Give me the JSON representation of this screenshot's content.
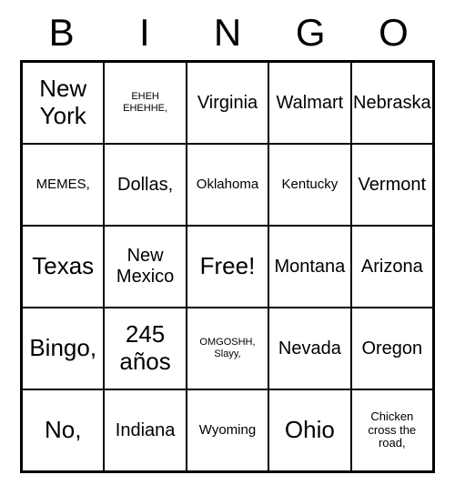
{
  "header": [
    "B",
    "I",
    "N",
    "G",
    "O"
  ],
  "cells": [
    {
      "text": "New York",
      "size": "big"
    },
    {
      "text": "EHEH EHEHHE,",
      "size": "tiny"
    },
    {
      "text": "Virginia",
      "size": "med"
    },
    {
      "text": "Walmart",
      "size": "med"
    },
    {
      "text": "Nebraska",
      "size": "med"
    },
    {
      "text": "MEMES,",
      "size": ""
    },
    {
      "text": "Dollas,",
      "size": "med"
    },
    {
      "text": "Oklahoma",
      "size": ""
    },
    {
      "text": "Kentucky",
      "size": ""
    },
    {
      "text": "Vermont",
      "size": "med"
    },
    {
      "text": "Texas",
      "size": "big"
    },
    {
      "text": "New Mexico",
      "size": "med"
    },
    {
      "text": "Free!",
      "size": "big"
    },
    {
      "text": "Montana",
      "size": "med"
    },
    {
      "text": "Arizona",
      "size": "med"
    },
    {
      "text": "Bingo,",
      "size": "big"
    },
    {
      "text": "245 años",
      "size": "big"
    },
    {
      "text": "OMGOSHH, Slayy,",
      "size": "tiny"
    },
    {
      "text": "Nevada",
      "size": "med"
    },
    {
      "text": "Oregon",
      "size": "med"
    },
    {
      "text": "No,",
      "size": "big"
    },
    {
      "text": "Indiana",
      "size": "med"
    },
    {
      "text": "Wyoming",
      "size": ""
    },
    {
      "text": "Ohio",
      "size": "big"
    },
    {
      "text": "Chicken cross the road,",
      "size": "small"
    }
  ]
}
